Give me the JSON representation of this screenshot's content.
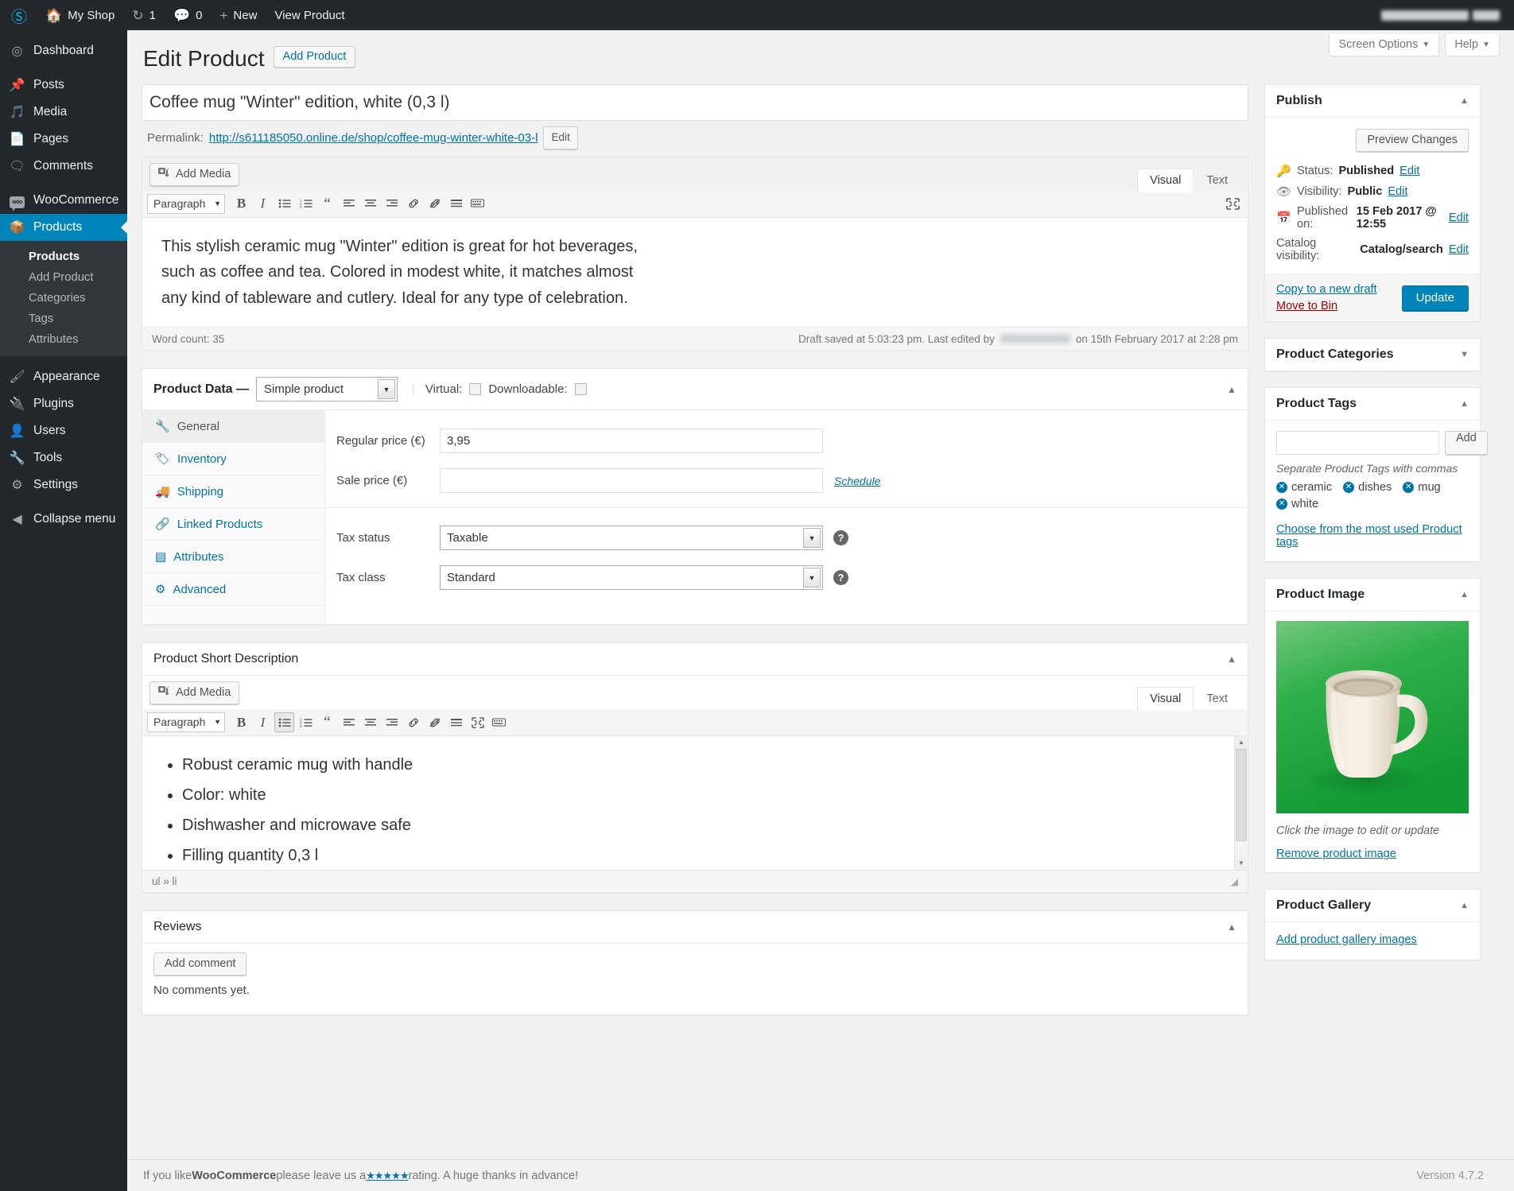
{
  "adminbar": {
    "logo_icon": "wordpress-logo-icon",
    "site_name": "My Shop",
    "updates_count": "1",
    "comments_count": "0",
    "new_label": "New",
    "view_product_label": "View Product"
  },
  "sidebar": {
    "items": [
      {
        "label": "Dashboard",
        "icon": "dashboard-icon"
      },
      {
        "label": "Posts",
        "icon": "pin-icon"
      },
      {
        "label": "Media",
        "icon": "media-icon"
      },
      {
        "label": "Pages",
        "icon": "pages-icon"
      },
      {
        "label": "Comments",
        "icon": "comment-icon"
      },
      {
        "label": "WooCommerce",
        "icon": "woocommerce-icon"
      },
      {
        "label": "Products",
        "icon": "products-box-icon"
      },
      {
        "label": "Appearance",
        "icon": "appearance-brush-icon"
      },
      {
        "label": "Plugins",
        "icon": "plugins-plug-icon"
      },
      {
        "label": "Users",
        "icon": "users-icon"
      },
      {
        "label": "Tools",
        "icon": "tools-hammer-icon"
      },
      {
        "label": "Settings",
        "icon": "settings-gear-icon"
      },
      {
        "label": "Collapse menu",
        "icon": "collapse-arrow-icon"
      }
    ],
    "submenu": [
      "Products",
      "Add Product",
      "Categories",
      "Tags",
      "Attributes"
    ]
  },
  "screen_meta": {
    "screen_options": "Screen Options",
    "help": "Help"
  },
  "page": {
    "title": "Edit Product",
    "add_new_label": "Add Product"
  },
  "post": {
    "title_value": "Coffee mug \"Winter\" edition, white (0,3 l)",
    "permalink_label": "Permalink:",
    "permalink_url": "http://s611185050.online.de/shop/coffee-mug-winter-white-03-l",
    "permalink_edit": "Edit"
  },
  "editor": {
    "add_media": "Add Media",
    "tab_visual": "Visual",
    "tab_text": "Text",
    "format_select": "Paragraph",
    "toolbar_icons": [
      "bold-icon",
      "italic-icon",
      "bulleted-list-icon",
      "numbered-list-icon",
      "blockquote-icon",
      "align-left-icon",
      "align-center-icon",
      "align-right-icon",
      "insert-link-icon",
      "remove-link-icon",
      "read-more-icon",
      "toolbar-toggle-icon"
    ],
    "fullscreen_icon": "distraction-free-icon",
    "content": "This stylish ceramic mug \"Winter\" edition is great for hot beverages, such as coffee and tea. Colored in modest white, it matches almost any kind of tableware and cutlery. Ideal for any type of celebration.",
    "word_count_label": "Word count: 35",
    "draft_saved": "Draft saved at 5:03:23 pm. Last edited by",
    "draft_saved_tail": "on 15th February 2017 at 2:28 pm"
  },
  "product_data": {
    "panel_title": "Product Data —",
    "product_type": "Simple product",
    "virtual_label": "Virtual:",
    "downloadable_label": "Downloadable:",
    "tabs": [
      {
        "label": "General",
        "icon": "wrench-icon"
      },
      {
        "label": "Inventory",
        "icon": "tag-icon"
      },
      {
        "label": "Shipping",
        "icon": "truck-icon"
      },
      {
        "label": "Linked Products",
        "icon": "link-icon"
      },
      {
        "label": "Attributes",
        "icon": "attributes-icon"
      },
      {
        "label": "Advanced",
        "icon": "gear-icon"
      }
    ],
    "fields": {
      "regular_price_label": "Regular price (€)",
      "regular_price_value": "3,95",
      "sale_price_label": "Sale price (€)",
      "sale_price_value": "",
      "schedule_label": "Schedule",
      "tax_status_label": "Tax status",
      "tax_status_value": "Taxable",
      "tax_class_label": "Tax class",
      "tax_class_value": "Standard",
      "help_icon": "question-mark-icon"
    }
  },
  "short_description": {
    "title": "Product Short Description",
    "add_media": "Add Media",
    "tab_visual": "Visual",
    "tab_text": "Text",
    "format_select": "Paragraph",
    "items": [
      "Robust ceramic mug with  handle",
      "Color: white",
      "Dishwasher and microwave safe",
      "Filling quantity 0,3 l"
    ],
    "path": "ul » li"
  },
  "reviews": {
    "title": "Reviews",
    "add_comment": "Add comment",
    "empty": "No comments yet."
  },
  "publish": {
    "title": "Publish",
    "preview_changes": "Preview Changes",
    "status_label": "Status:",
    "status_value": "Published",
    "status_edit": "Edit",
    "visibility_label": "Visibility:",
    "visibility_value": "Public",
    "visibility_edit": "Edit",
    "published_label": "Published on:",
    "published_value": "15 Feb 2017 @ 12:55",
    "published_edit": "Edit",
    "catalog_label": "Catalog visibility:",
    "catalog_value": "Catalog/search",
    "catalog_edit": "Edit",
    "copy_draft": "Copy to a new draft",
    "move_to_bin": "Move to Bin",
    "update": "Update",
    "icons": {
      "status": "key-icon",
      "visibility": "eye-icon",
      "published": "calendar-icon"
    }
  },
  "categories_box": {
    "title": "Product Categories"
  },
  "tags_box": {
    "title": "Product Tags",
    "input_value": "",
    "add_label": "Add",
    "hint": "Separate Product Tags with commas",
    "tags": [
      "ceramic",
      "dishes",
      "mug",
      "white"
    ],
    "choose_link": "Choose from the most used Product tags"
  },
  "image_box": {
    "title": "Product Image",
    "hint": "Click the image to edit or update",
    "remove_link": "Remove product image",
    "alt": "white ceramic coffee mug on green background"
  },
  "gallery_box": {
    "title": "Product Gallery",
    "add_link": "Add product gallery images"
  },
  "footer": {
    "text_before": "If you like ",
    "brand": "WooCommerce",
    "text_mid": " please leave us a ",
    "stars": "★★★★★",
    "text_after": " rating. A huge thanks in advance!",
    "version": "Version 4.7.2"
  },
  "colors": {
    "accent": "#0073aa",
    "primary_button": "#0085ba",
    "admin_bg": "#23282d",
    "danger": "#a00"
  }
}
